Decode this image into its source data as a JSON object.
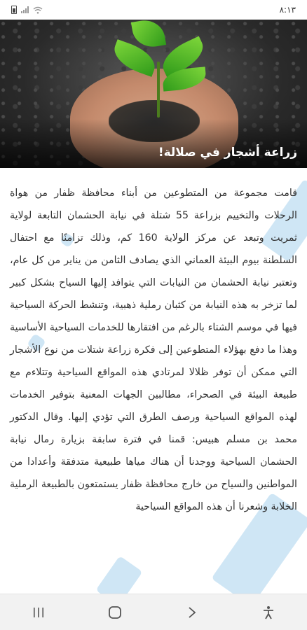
{
  "status_bar": {
    "time": "٨:١٣",
    "icons": [
      "battery-icon",
      "signal-icon",
      "wifi-icon"
    ]
  },
  "hero": {
    "title": "زراعة أشجار في صلالة!",
    "image": "seedling-in-hands"
  },
  "article": {
    "body": "قامت مجموعة من المتطوعين من أبناء محافظة ظفار من هواة الرحلات والتخييم بزراعة 55 شتلة في نيابة الحشمان التابعة لولاية ثمريت وتبعد عن مركز الولاية 160 كم، وذلك تزامنًا مع احتفال السلطنة بيوم البيئة العماني الذي يصادف الثامن من يناير من كل عام، وتعتبر نيابة الحشمان من النيابات التي يتوافد إليها السياح بشكل كبير لما تزخر به هذه النيابة من كثبان رملية ذهبية، وتنشط الحركة السياحية فيها في موسم الشتاء بالرغم من افتقارها للخدمات السياحية الأساسية وهذا ما دفع بهؤلاء المتطوعين إلى فكرة زراعة شتلات من نوع الأشجار التي ممكن أن توفر ظلالا لمرتادي هذه المواقع السياحية وتتلاءم مع طبيعة البيئة في الصحراء، مطالبين الجهات المعنية بتوفير الخدمات لهذه المواقع السياحية ورصف الطرق التي تؤدي إليها. وقال الدكتور محمد بن مسلم هبيس: قمنا في فترة سابقة بزيارة رمال نيابة الحشمان السياحية ووجدنا أن هناك مياها طبيعية متدفقة وأعدادا من المواطنين والسياح من خارج محافظة ظفار يستمتعون بالطبيعة الرملية الخلابة وشعرنا أن هذه المواقع السياحية"
  },
  "nav_bar": {
    "buttons": [
      "recents-button",
      "home-button",
      "back-button",
      "accessibility-button"
    ]
  },
  "colors": {
    "text": "#333333",
    "hero_title": "#ffffff",
    "decor_shapes": "#a8d2ec",
    "nav_bg": "#f2f2f2"
  }
}
